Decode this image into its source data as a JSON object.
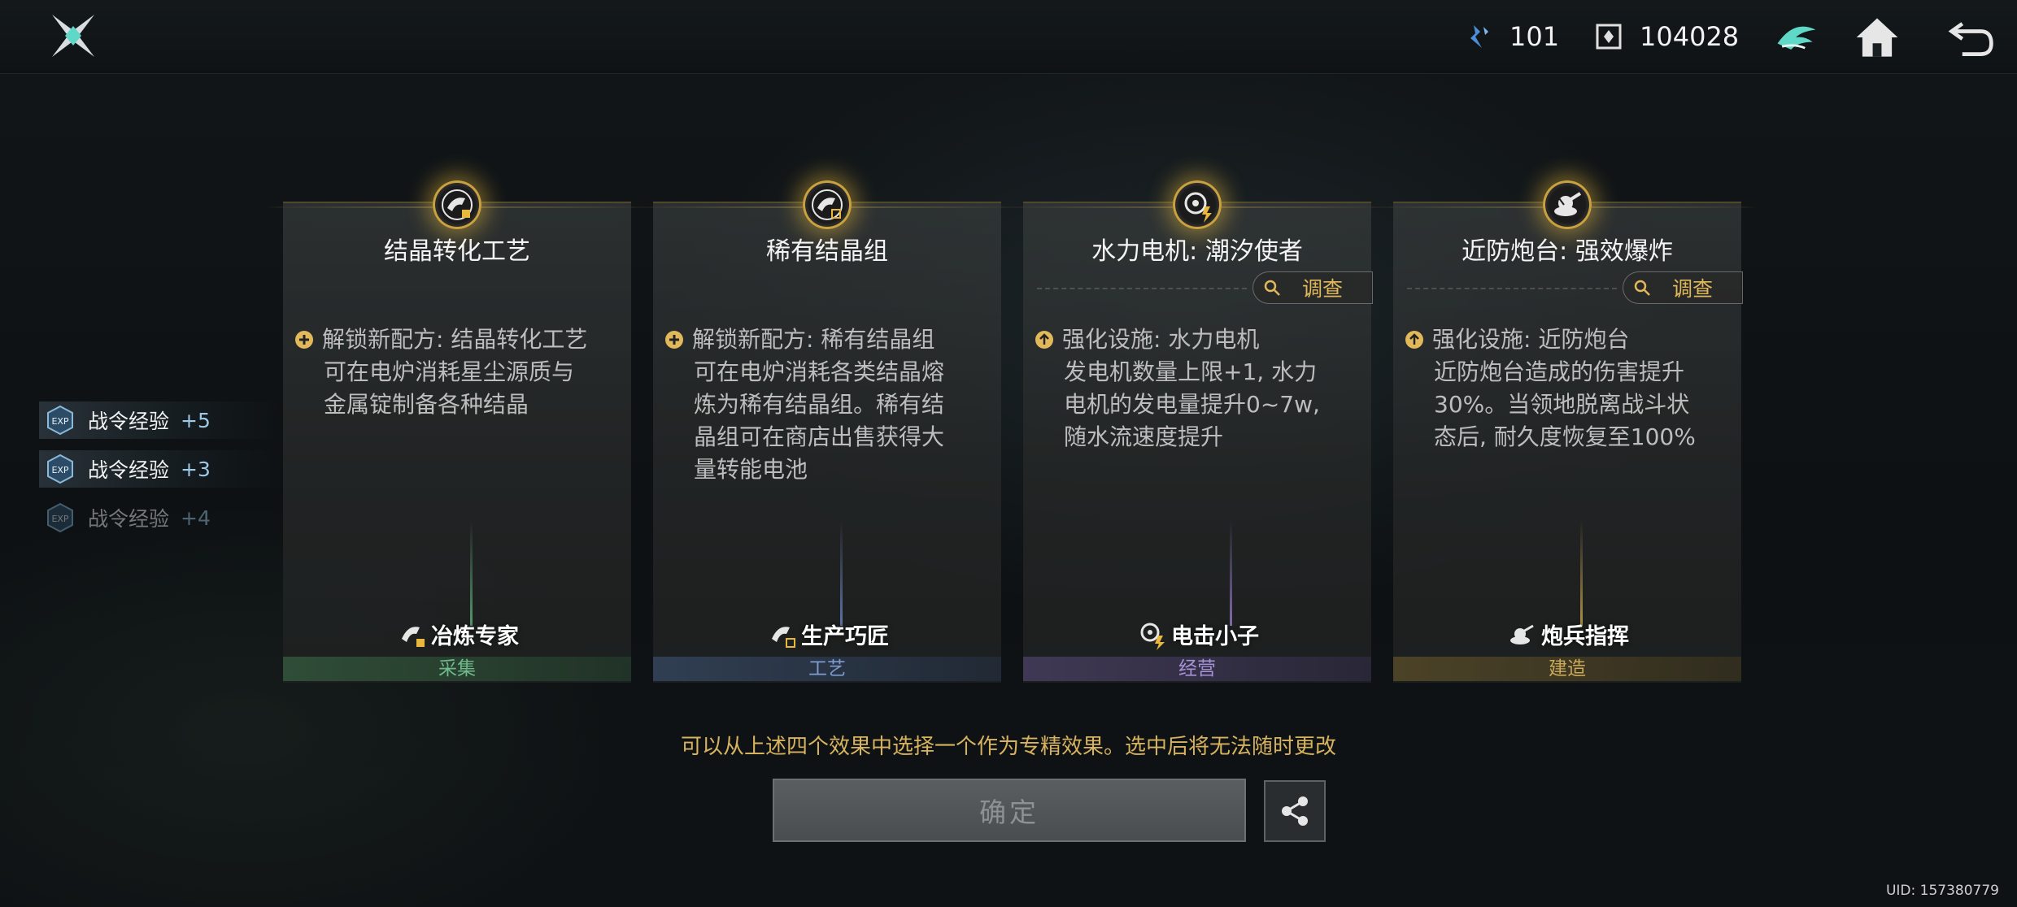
{
  "topbar": {
    "resource1": {
      "icon": "shard-icon",
      "value": "101"
    },
    "resource2": {
      "icon": "cube-icon",
      "value": "104028"
    },
    "uid": "UID: 157380779"
  },
  "exp_list": [
    {
      "label": "战令经验",
      "value": "+5"
    },
    {
      "label": "战令经验",
      "value": "+3"
    },
    {
      "label": "战令经验",
      "value": "+4"
    }
  ],
  "cards": [
    {
      "title": "结晶转化工艺",
      "icon": "plus-circle-icon",
      "desc_head": "解锁新配方: 结晶转化工艺",
      "desc_body": "可在电炉消耗星尘源质与金属锭制备各种结晶",
      "specialist": "冶炼专家",
      "category": "采集",
      "color": "#3b6b47"
    },
    {
      "title": "稀有结晶组",
      "icon": "plus-circle-icon",
      "desc_head": "解锁新配方: 稀有结晶组",
      "desc_body": "可在电炉消耗各类结晶熔炼为稀有结晶组。稀有结晶组可在商店出售获得大量转能电池",
      "specialist": "生产巧匠",
      "category": "工艺",
      "color": "#3e5475"
    },
    {
      "title": "水力电机: 潮汐使者",
      "survey": "调查",
      "icon": "arrow-up-circle-icon",
      "desc_head": "强化设施: 水力电机",
      "desc_body": "发电机数量上限+1, 水力电机的发电量提升0~7w, 随水流速度提升",
      "specialist": "电击小子",
      "category": "经营",
      "color": "#574a78"
    },
    {
      "title": "近防炮台: 强效爆炸",
      "survey": "调查",
      "icon": "arrow-up-circle-icon",
      "desc_head": "强化设施: 近防炮台",
      "desc_body": "近防炮台造成的伤害提升30%。当领地脱离战斗状态后, 耐久度恢复至100%",
      "specialist": "炮兵指挥",
      "category": "建造",
      "color": "#6b5a2c"
    }
  ],
  "hint": "可以从上述四个效果中选择一个作为专精效果。选中后将无法随时更改",
  "confirm_label": "确定"
}
